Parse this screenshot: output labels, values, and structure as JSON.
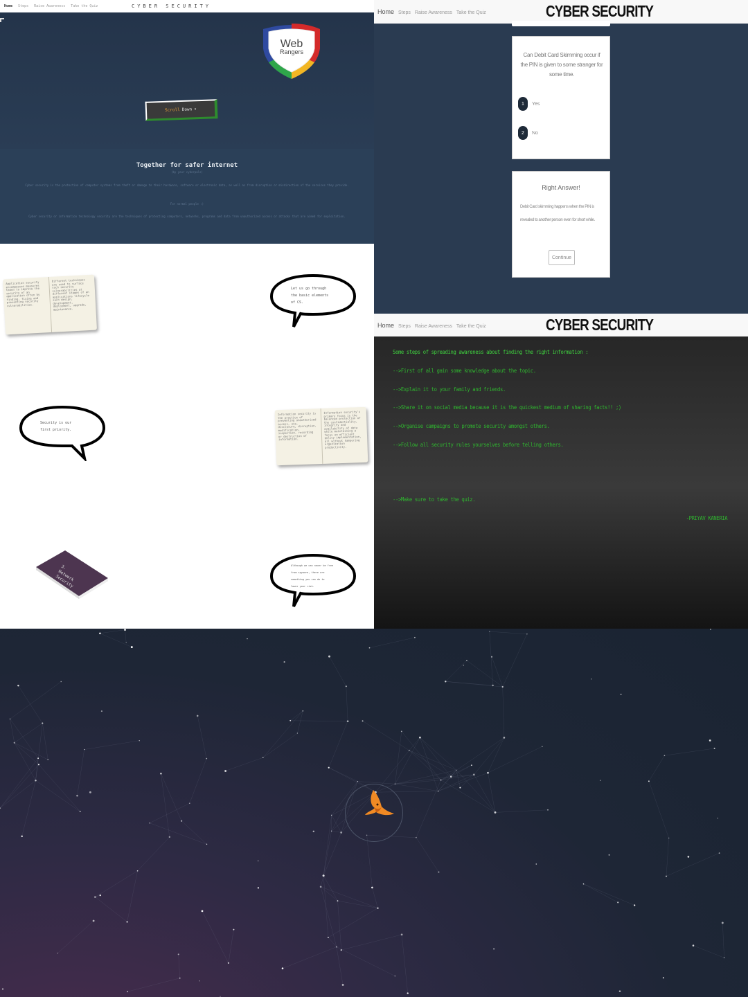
{
  "panel_home": {
    "nav": {
      "items": [
        "Home",
        "Steps",
        "Raise Awareness",
        "Take the Quiz"
      ],
      "brand": "CYBER SECURITY"
    },
    "logo": {
      "line1": "Web",
      "line2": "Rangers"
    },
    "scroll_button": {
      "label": "Scroll",
      "label_accent": "Down"
    },
    "about": {
      "title": "Together for safer internet",
      "subtitle": "(by your cyberpals)",
      "paragraph1": "Cyber security is the protection of computer systems from theft or damage to their hardware, software or electronic data, as well as from disruption or misdirection of the services they provide.",
      "tagline": "For normal people :)",
      "paragraph2": "Cyber security or information technology security are the techniques of protecting computers, networks, programs and data from unauthorized access or attacks that are aimed for exploitation."
    },
    "book1": {
      "left": "Application security encompasses measures taken to improve the security of an application often by finding, fixing and preventing security vulnerabilities.",
      "right": "Different techniques are used to surface such security vulnerabilities at different stages of an applications lifecycle such design, development, deployment, upgrade, maintenance."
    },
    "bubble1": [
      "Let us go through",
      "the basic elements",
      "of CS."
    ],
    "bubble2": [
      "Security is our",
      "first priority."
    ],
    "book2": {
      "left": "Information security is the practice of preventing unauthorized access, use, disclosure, disruption, modification, inspection, recording or destruction of information.",
      "right": "Information security's primary focus is the balanced protection of the confidentiality, integrity and availability of data while maintaining a focus on efficient policy implementation, all without hampering organization productivity."
    },
    "book3_title": [
      "3.",
      "Network",
      "Security"
    ],
    "bubble3": [
      "Although we can never be free",
      "from spyware, there are",
      "something you can do to",
      "lower your risk."
    ]
  },
  "panel_quiz": {
    "nav": {
      "items": [
        "Home",
        "Steps",
        "Raise Awareness",
        "Take the Quiz"
      ],
      "brand": "CYBER SECURITY"
    },
    "question": "Can Debit Card Skimming occur if the PIN is given to some stranger for some time.",
    "options": [
      {
        "num": "1",
        "label": "Yes"
      },
      {
        "num": "2",
        "label": "No"
      }
    ],
    "answer": {
      "title": "Right Answer!",
      "body": "Debit Card skimming happens when the PIN is revealed to another person even for short while.",
      "button": "Continue"
    }
  },
  "panel_awareness": {
    "nav": {
      "items": [
        "Home",
        "Steps",
        "Raise Awareness",
        "Take the Quiz"
      ],
      "brand": "CYBER SECURITY"
    },
    "heading": "Some steps of spreading awareness about finding the right information :",
    "steps": [
      "-->First of all gain some knowledge about the topic.",
      "-->Explain it to your family and friends.",
      "-->Share it on social media because it is the quickest medium of sharing facts!! ;)",
      "-->Organise campaigns to promote security amongst others.",
      "-->Follow all security rules yourselves before telling others."
    ],
    "final": "-->Make sure to take the quiz.",
    "signature": "-PRIYAV KANERIA"
  },
  "panel_loader": {
    "icon": "fox-logo-icon"
  },
  "colors": {
    "hero_bg": "#24344a",
    "quiz_bg": "#2a3b51",
    "terminal_green": "#2fb52f",
    "loader_orange": "#f08a24"
  }
}
